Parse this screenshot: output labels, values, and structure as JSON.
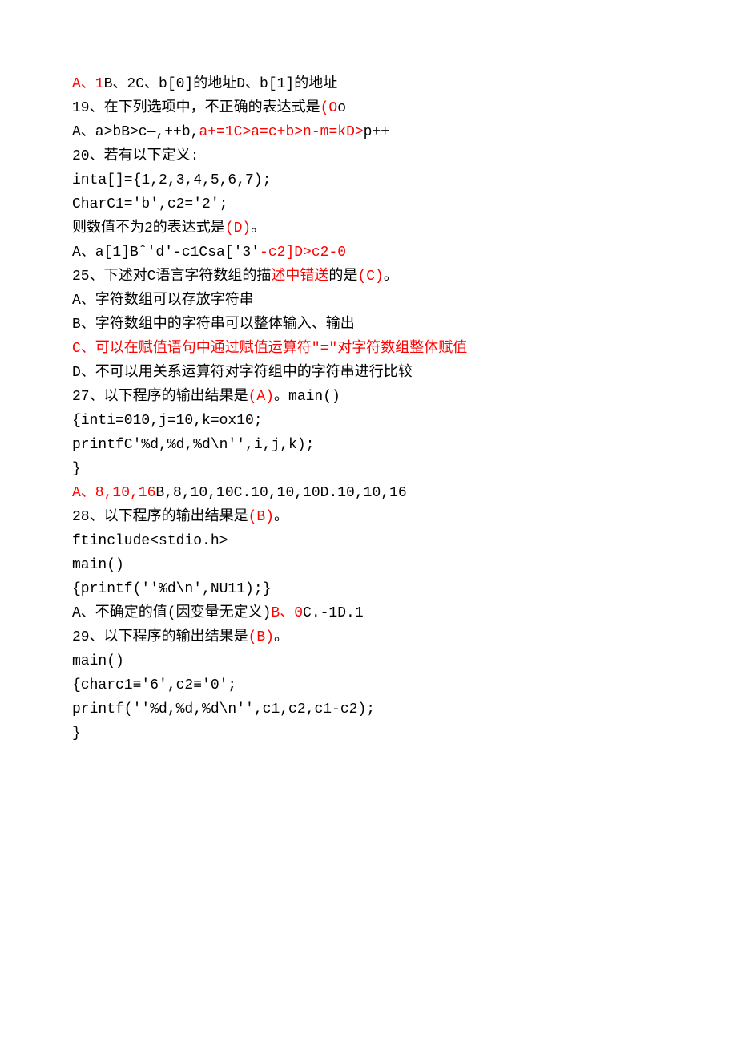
{
  "lines": [
    [
      {
        "t": "A、1",
        "c": "red"
      },
      {
        "t": "B、2C、b[0]的地址D、b[1]的地址"
      }
    ],
    [
      {
        "t": "19、在下列选项中，不正确的表达式是"
      },
      {
        "t": "(O",
        "c": "red"
      },
      {
        "t": "o"
      }
    ],
    [
      {
        "t": "A、a>bB>c—,++b,"
      },
      {
        "t": "a+=1C>a=c+b>n-m=kD>",
        "c": "red"
      },
      {
        "t": "p++"
      }
    ],
    [
      {
        "t": "20、若有以下定义:"
      }
    ],
    [
      {
        "t": "inta[]={1,2,3,4,5,6,7);"
      }
    ],
    [
      {
        "t": "CharC1='b',c2='2';"
      }
    ],
    [
      {
        "t": "则数值不为2的表达式是"
      },
      {
        "t": "(D)",
        "c": "red"
      },
      {
        "t": "。"
      }
    ],
    [
      {
        "t": "A、a[1]Bˆ'd'-c1Csa['3'"
      },
      {
        "t": "-c2]D>c2-0",
        "c": "red"
      }
    ],
    [
      {
        "t": "25、下述对C语言字符数组的描"
      },
      {
        "t": "述中错送",
        "c": "red"
      },
      {
        "t": "的是"
      },
      {
        "t": "(C)",
        "c": "red"
      },
      {
        "t": "。"
      }
    ],
    [
      {
        "t": "A、字符数组可以存放字符串"
      }
    ],
    [
      {
        "t": "B、字符数组中的字符串可以整体输入、输出"
      }
    ],
    [
      {
        "t": "C、可以在赋值语句中通过赋值运算符\"=\"对字符数组整体赋值",
        "c": "red"
      }
    ],
    [
      {
        "t": "D、不可以用关系运算符对字符组中的字符串进行比较"
      }
    ],
    [
      {
        "t": "27、以下程序的输出结果是"
      },
      {
        "t": "(A)",
        "c": "red"
      },
      {
        "t": "。main()"
      }
    ],
    [
      {
        "t": "{inti=010,j=10,k=ox10;"
      }
    ],
    [
      {
        "t": "printfC'%d,%d,%d\\n'',i,j,k);"
      }
    ],
    [
      {
        "t": "}"
      }
    ],
    [
      {
        "t": "A、8,10,16",
        "c": "red"
      },
      {
        "t": "B,8,10,10C.10,10,10D.10,10,16"
      }
    ],
    [
      {
        "t": "28、以下程序的输出结果是"
      },
      {
        "t": "(B)",
        "c": "red"
      },
      {
        "t": "。"
      }
    ],
    [
      {
        "t": "ftinclude<stdio.h>"
      }
    ],
    [
      {
        "t": "main()"
      }
    ],
    [
      {
        "t": "{printf(''%d\\n',NU11);}"
      }
    ],
    [
      {
        "t": "A、不确定的值(因变量无定义)"
      },
      {
        "t": "B、0",
        "c": "red"
      },
      {
        "t": "C.-1D.1"
      }
    ],
    [
      {
        "t": "29、以下程序的输出结果是"
      },
      {
        "t": "(B)",
        "c": "red"
      },
      {
        "t": "。"
      }
    ],
    [
      {
        "t": "main()"
      }
    ],
    [
      {
        "t": "{charc1≡'6',c2≡'0';"
      }
    ],
    [
      {
        "t": "printf(''%d,%d,%d\\n'',c1,c2,c1-c2);"
      }
    ],
    [
      {
        "t": "}"
      }
    ]
  ]
}
